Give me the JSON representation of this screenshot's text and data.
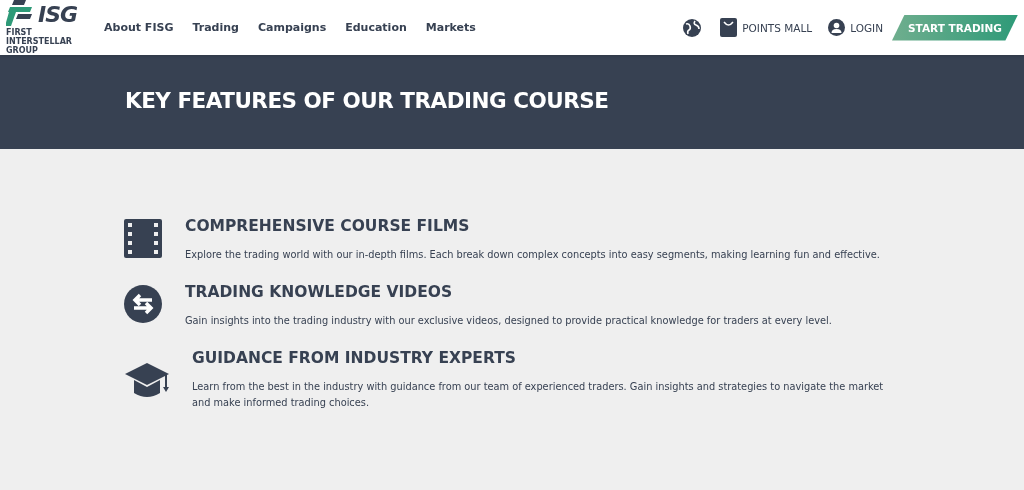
{
  "header": {
    "logo": {
      "mark": "ISG",
      "tagline": "FIRST INTERSTELLAR GROUP"
    },
    "nav": [
      "About FISG",
      "Trading",
      "Campaigns",
      "Education",
      "Markets"
    ],
    "points_mall": "POINTS MALL",
    "login": "LOGIN",
    "cta": "START TRADING"
  },
  "banner": {
    "title": "KEY FEATURES OF OUR TRADING COURSE"
  },
  "features": [
    {
      "kind": "film",
      "title": "COMPREHENSIVE COURSE FILMS",
      "text": "Explore the trading world with our in-depth films. Each break down complex concepts into easy segments, making learning fun and effective."
    },
    {
      "kind": "exchange",
      "title": "TRADING KNOWLEDGE VIDEOS",
      "text": "Gain insights into the trading industry with our exclusive videos, designed to provide practical knowledge for traders at every level."
    },
    {
      "kind": "graduation",
      "title": "GUIDANCE FROM INDUSTRY EXPERTS",
      "text": "Learn from the best in the industry with guidance from our team of experienced traders. Gain insights and strategies to navigate the market and make informed trading choices."
    }
  ]
}
